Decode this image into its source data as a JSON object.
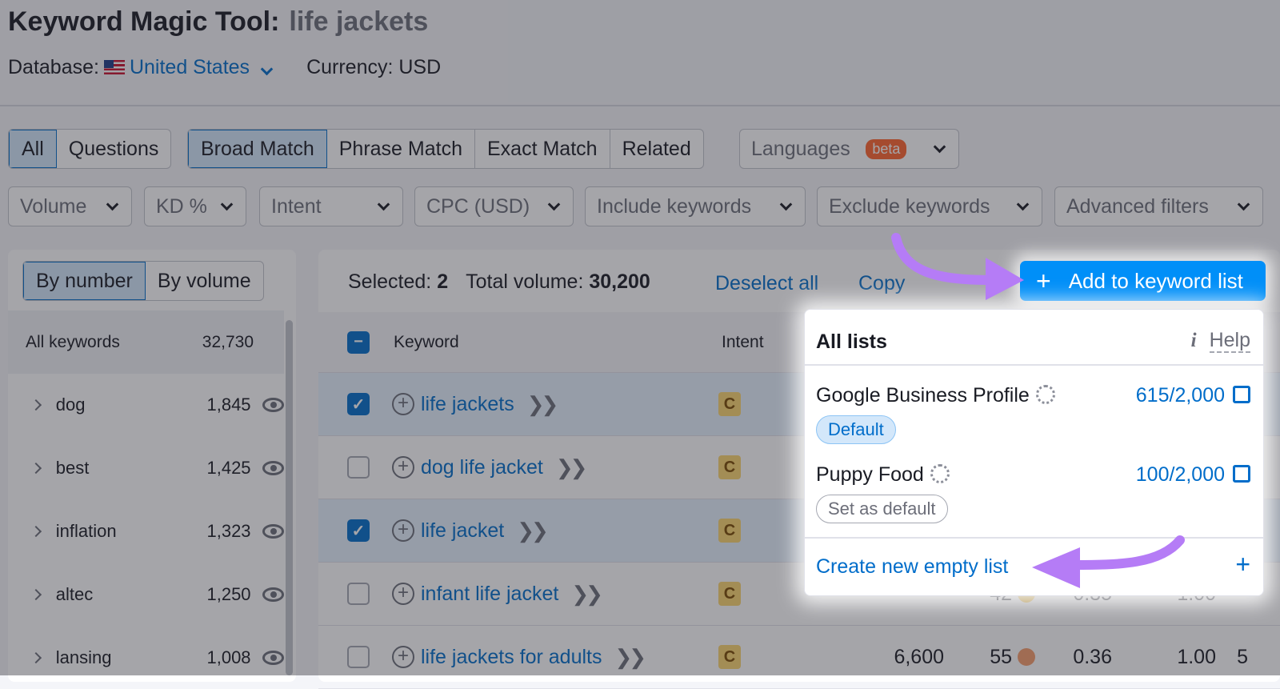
{
  "header": {
    "title": "Keyword Magic Tool:",
    "query": "life jackets",
    "database_label": "Database:",
    "database_value": "United States",
    "currency": "Currency: USD"
  },
  "tabs": {
    "all": "All",
    "questions": "Questions",
    "broad": "Broad Match",
    "phrase": "Phrase Match",
    "exact": "Exact Match",
    "related": "Related",
    "languages": "Languages",
    "beta": "beta"
  },
  "filters": [
    "Volume",
    "KD %",
    "Intent",
    "CPC (USD)",
    "Include keywords",
    "Exclude keywords",
    "Advanced filters"
  ],
  "sidebar": {
    "by_number": "By number",
    "by_volume": "By volume",
    "all_label": "All keywords",
    "all_count": "32,730",
    "items": [
      {
        "label": "dog",
        "count": "1,845"
      },
      {
        "label": "best",
        "count": "1,425"
      },
      {
        "label": "inflation",
        "count": "1,323"
      },
      {
        "label": "altec",
        "count": "1,250"
      },
      {
        "label": "lansing",
        "count": "1,008"
      }
    ]
  },
  "selection": {
    "selected_label": "Selected:",
    "selected": "2",
    "total_label": "Total volume:",
    "total": "30,200",
    "deselect": "Deselect all",
    "copy": "Copy",
    "add_button": "Add to keyword list"
  },
  "table": {
    "col_keyword": "Keyword",
    "col_intent": "Intent",
    "rows": [
      {
        "keyword": "life jackets",
        "intent": "C",
        "checked": true
      },
      {
        "keyword": "dog life jacket",
        "intent": "C",
        "checked": false
      },
      {
        "keyword": "life jacket",
        "intent": "C",
        "checked": true
      },
      {
        "keyword": "infant life jacket",
        "intent": "C",
        "checked": false,
        "kd": "42",
        "cpc": "0.35",
        "com": "1.00"
      },
      {
        "keyword": "life jackets for adults",
        "intent": "C",
        "checked": false,
        "volume": "6,600",
        "kd": "55",
        "cpc": "0.36",
        "com": "1.00",
        "results": "5"
      }
    ]
  },
  "menu": {
    "title": "All lists",
    "help": "Help",
    "lists": [
      {
        "name": "Google Business Profile",
        "count": "615/2,000",
        "badge": "Default"
      },
      {
        "name": "Puppy Food",
        "count": "100/2,000",
        "badge": "Set as default"
      }
    ],
    "create": "Create new empty list",
    "create_icon": "+"
  },
  "colors": {
    "accent": "#008ff8",
    "link": "#006dca",
    "arrow": "#b57cf6",
    "beta": "#ff642d"
  }
}
